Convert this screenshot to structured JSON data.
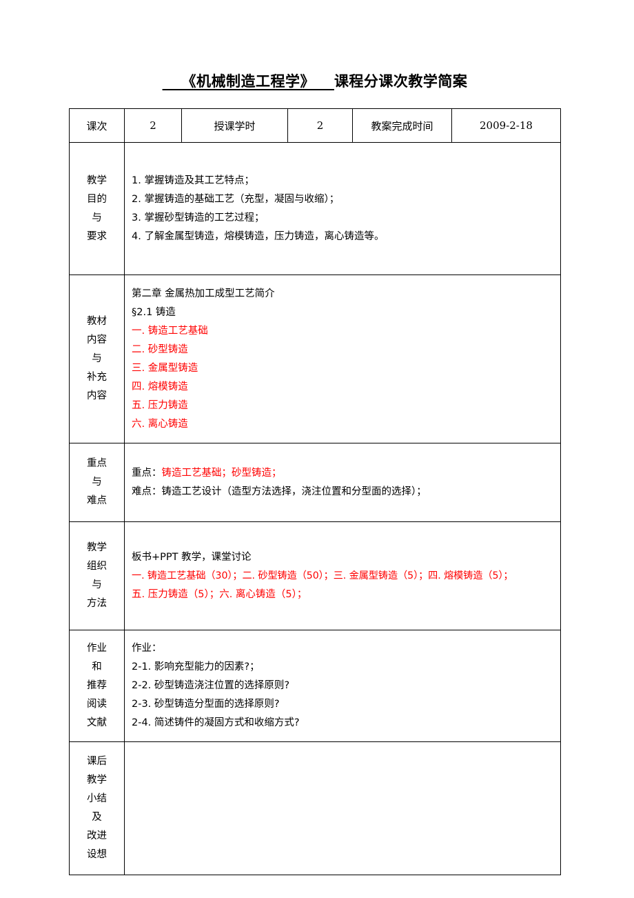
{
  "title": {
    "underlined_part": "《机械制造工程学》",
    "rest": "课程分课次教学简案"
  },
  "header_row": {
    "label_lesson": "课次",
    "value_lesson": "2",
    "label_hours": "授课学时",
    "value_hours": "2",
    "label_date": "教案完成时间",
    "value_date": "2009-2-18"
  },
  "rows": [
    {
      "label_lines": [
        "教学",
        "目的",
        "与",
        "要求"
      ],
      "content_lines": [
        {
          "text": "1. 掌握铸造及其工艺特点；",
          "color": "black"
        },
        {
          "text": "2. 掌握铸造的基础工艺（充型，凝固与收缩）；",
          "color": "black"
        },
        {
          "text": "3. 掌握砂型铸造的工艺过程；",
          "color": "black"
        },
        {
          "text": "4. 了解金属型铸造，熔模铸造，压力铸造，离心铸造等。",
          "color": "black"
        }
      ]
    },
    {
      "label_lines": [
        "教材",
        "内容",
        "与",
        "补充",
        "内容"
      ],
      "content_lines": [
        {
          "text": "第二章  金属热加工成型工艺简介",
          "color": "black"
        },
        {
          "text": "§2.1  铸造",
          "color": "black"
        },
        {
          "text": "一. 铸造工艺基础",
          "color": "red"
        },
        {
          "text": "二. 砂型铸造",
          "color": "red"
        },
        {
          "text": "三. 金属型铸造",
          "color": "red"
        },
        {
          "text": "四. 熔模铸造",
          "color": "red"
        },
        {
          "text": "五. 压力铸造",
          "color": "red"
        },
        {
          "text": "六. 离心铸造",
          "color": "red"
        }
      ]
    },
    {
      "label_lines": [
        "重点",
        "与",
        "难点"
      ],
      "content_lines": [
        {
          "segments": [
            {
              "text": "重点：",
              "color": "black"
            },
            {
              "text": "铸造工艺基础；砂型铸造；",
              "color": "red"
            }
          ]
        },
        {
          "text": "难点：铸造工艺设计（造型方法选择，浇注位置和分型面的选择）；",
          "color": "black"
        }
      ]
    },
    {
      "label_lines": [
        "教学",
        "组织",
        "与",
        "方法"
      ],
      "content_lines": [
        {
          "text": "板书+PPT 教学，课堂讨论",
          "color": "black"
        },
        {
          "text": "一. 铸造工艺基础（30）；二. 砂型铸造（50）；三. 金属型铸造（5）；四. 熔模铸造（5）；",
          "color": "red",
          "small": true
        },
        {
          "text": "五. 压力铸造（5）；六. 离心铸造（5）；",
          "color": "red"
        }
      ]
    },
    {
      "label_lines": [
        "作业",
        "和",
        "推荐",
        "阅读",
        "文献"
      ],
      "content_lines": [
        {
          "text": " 作业：",
          "color": "black"
        },
        {
          "text": "2-1. 影响充型能力的因素?；",
          "color": "black"
        },
        {
          "text": "2-2. 砂型铸造浇注位置的选择原则?",
          "color": "black"
        },
        {
          "text": "2-3. 砂型铸造分型面的选择原则?",
          "color": "black"
        },
        {
          "text": "2-4. 简述铸件的凝固方式和收缩方式?",
          "color": "black"
        }
      ]
    },
    {
      "label_lines": [
        "课后",
        "教学",
        "小结",
        "及",
        "改进",
        "设想"
      ],
      "content_lines": []
    }
  ]
}
